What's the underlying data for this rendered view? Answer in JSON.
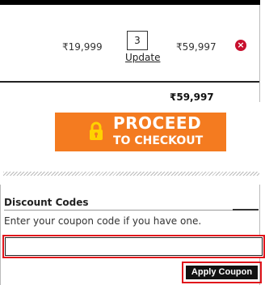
{
  "cart": {
    "item": {
      "unit_price": "₹19,999",
      "quantity": "3",
      "update_label": "Update",
      "line_total": "₹59,997",
      "remove_icon": "remove-circle-icon"
    },
    "grand_total": "₹59,997"
  },
  "checkout_button": {
    "line1": "PROCEED",
    "line2": "TO CHECKOUT",
    "icon": "lock-icon",
    "color": "#f47b20"
  },
  "discount": {
    "title": "Discount Codes",
    "hint": "Enter your coupon code if you have one.",
    "input_value": "",
    "apply_label": "Apply Coupon",
    "highlight_color": "#e0141b"
  }
}
